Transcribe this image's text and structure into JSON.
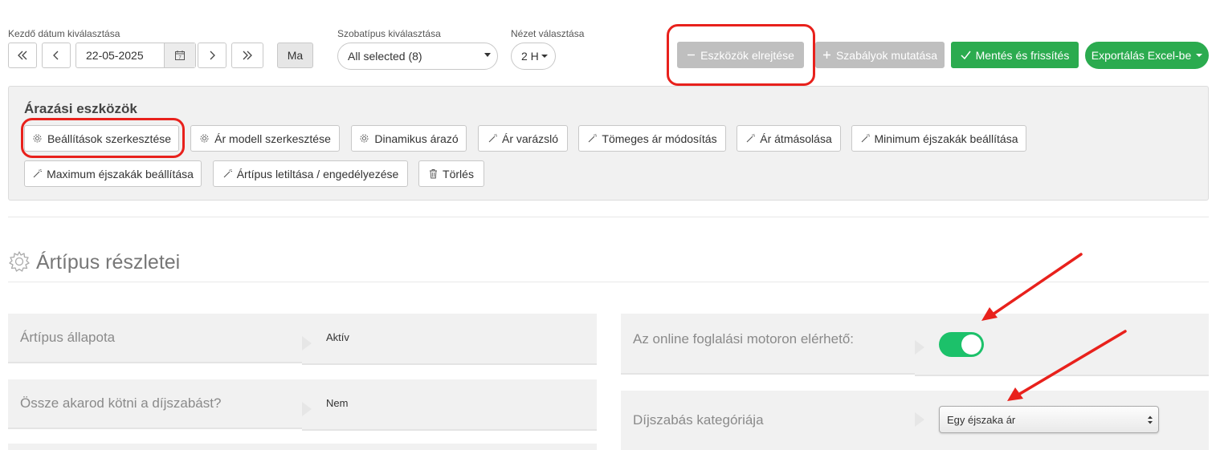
{
  "header": {
    "date_label": "Kezdő dátum kiválasztása",
    "date_value": "22-05-2025",
    "today_label": "Ma",
    "room_label": "Szobatípus kiválasztása",
    "room_value": "All selected (8)",
    "view_label": "Nézet választása",
    "view_value": "2 H",
    "hide_tools_label": "Eszközök elrejtése",
    "show_rules_label": "Szabályok mutatása",
    "save_label": "Mentés és frissítés",
    "export_label": "Exportálás Excel-be"
  },
  "tools": {
    "title": "Árazási eszközök",
    "items": [
      {
        "label": "Beállítások szerkesztése",
        "icon": "gear-icon"
      },
      {
        "label": "Ár modell szerkesztése",
        "icon": "gear-icon"
      },
      {
        "label": "Dinamikus árazó",
        "icon": "gear-icon"
      },
      {
        "label": "Ár varázsló",
        "icon": "wand-icon"
      },
      {
        "label": "Tömeges ár módosítás",
        "icon": "wand-icon"
      },
      {
        "label": "Ár átmásolása",
        "icon": "wand-icon"
      },
      {
        "label": "Minimum éjszakák beállítása",
        "icon": "wand-icon"
      },
      {
        "label": "Maximum éjszakák beállítása",
        "icon": "wand-icon"
      },
      {
        "label": "Ártípus letiltása / engedélyezése",
        "icon": "wand-icon"
      },
      {
        "label": "Törlés",
        "icon": "trash-icon"
      }
    ]
  },
  "details": {
    "title": "Ártípus részletei",
    "rows_left": [
      {
        "label": "Ártípus állapota",
        "value": "Aktív"
      },
      {
        "label": "Össze akarod kötni a díjszabást?",
        "value": "Nem"
      }
    ],
    "online_label": "Az online foglalási motoron elérhető:",
    "online_enabled": true,
    "category_label": "Díjszabás kategóriája",
    "category_value": "Egy éjszaka ár"
  },
  "colors": {
    "green": "#2bab4f",
    "toggle_green": "#1cc16a",
    "highlight_red": "#e8211c",
    "disabled_gray": "#bfbfbf"
  }
}
